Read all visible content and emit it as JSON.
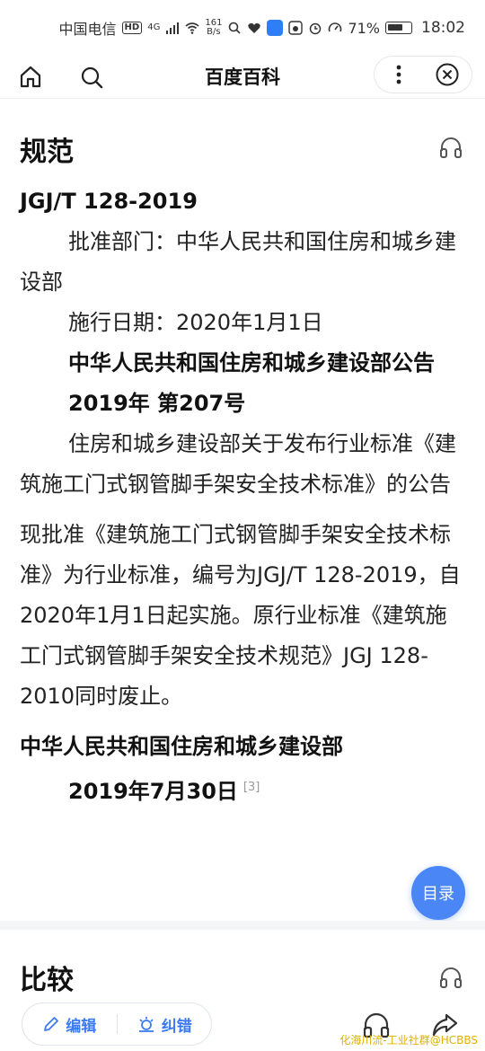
{
  "status_bar": {
    "carrier": "中国电信",
    "hd": "HD",
    "network": "4G",
    "speed_value": "161",
    "speed_unit": "B/s",
    "battery": "71%",
    "battery_level": 0.71,
    "time": "18:02"
  },
  "nav": {
    "title": "百度百科"
  },
  "section1": {
    "title": "规范",
    "code": "JGJ/T 128-2019",
    "approval_dept": "批准部门：中华人民共和国住房和城乡建设部",
    "effective_date": "施行日期：2020年1月1日",
    "notice_title": "中华人民共和国住房和城乡建设部公告",
    "notice_no": "2019年 第207号",
    "notice_subject": "住房和城乡建设部关于发布行业标准《建筑施工门式钢管脚手架安全技术标准》的公告",
    "body": "现批准《建筑施工门式钢管脚手架安全技术标准》为行业标准，编号为JGJ/T 128-2019，自2020年1月1日起实施。原行业标准《建筑施工门式钢管脚手架安全技术规范》JGJ 128-2010同时废止。",
    "signature": "中华人民共和国住房和城乡建设部",
    "date": "2019年7月30日",
    "ref": "[3]"
  },
  "toc_button": "目录",
  "section2": {
    "title": "比较"
  },
  "bottom": {
    "edit_label": "编辑",
    "correct_label": "纠错",
    "watermark": "化海川流-工业社群@HCBBS"
  },
  "colors": {
    "accent": "#3b7af0",
    "toc_bg": "#4a86f6",
    "watermark": "#e0b000"
  }
}
